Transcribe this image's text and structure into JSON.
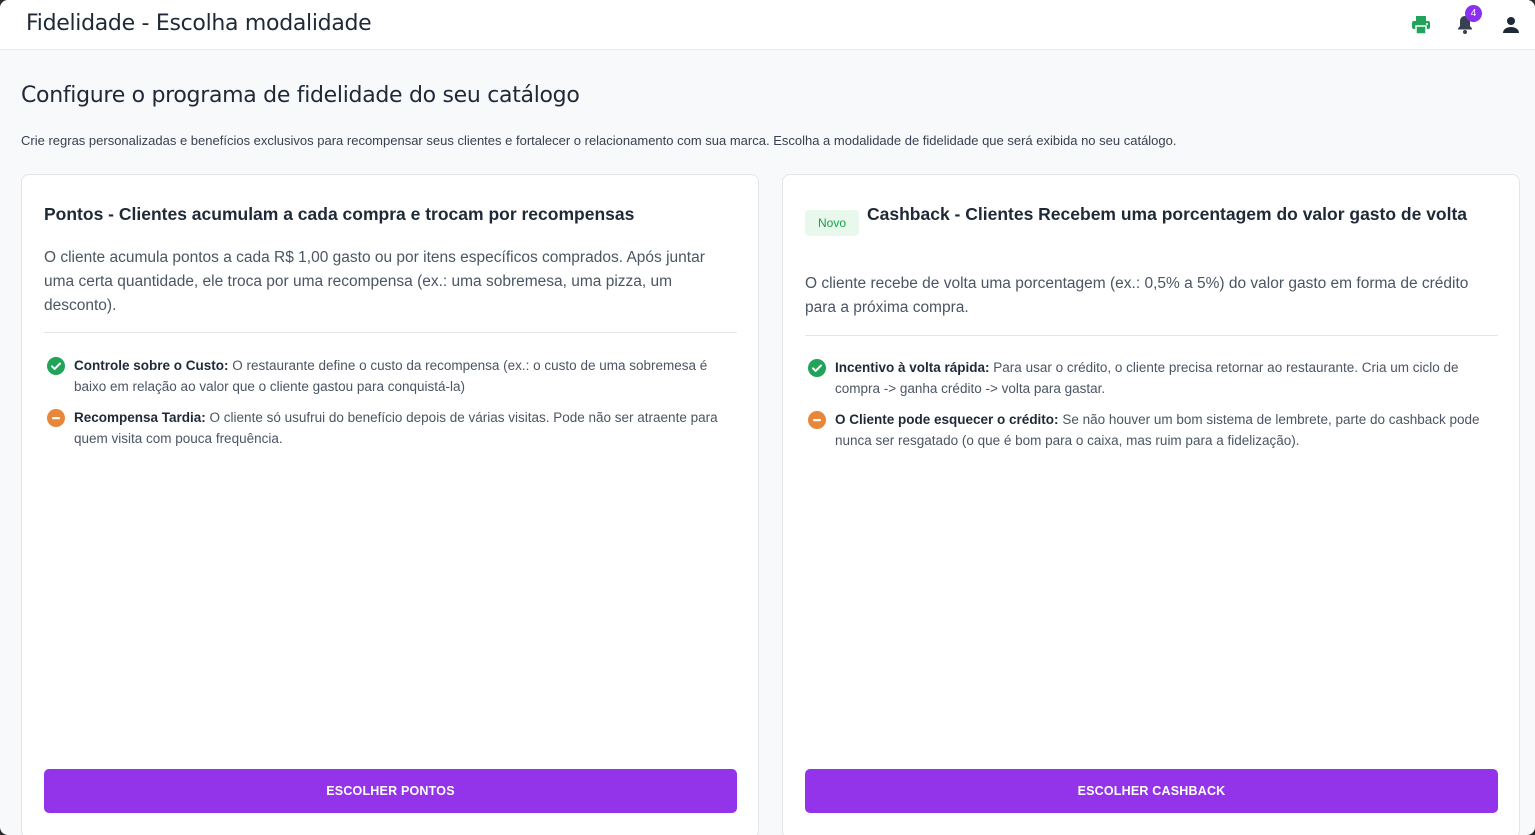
{
  "header": {
    "title": "Fidelidade - Escolha modalidade",
    "icons": [
      "printer-icon",
      "bell-icon",
      "user-icon"
    ],
    "notification_count": "4",
    "colors": {
      "printer": "#22a35a",
      "badge": "#8b2ff0"
    }
  },
  "main": {
    "heading": "Configure o programa de fidelidade do seu catálogo",
    "description": "Crie regras personalizadas e benefícios exclusivos para recompensar seus clientes e fortalecer o relacionamento com sua marca. Escolha a modalidade de fidelidade que será exibida no seu catálogo."
  },
  "cards": [
    {
      "title": "Pontos - Clientes acumulam a cada compra e trocam por recompensas",
      "description": "O cliente acumula pontos a cada R$ 1,00 gasto ou por itens específicos comprados. Após juntar uma certa quantidade, ele troca por uma recompensa (ex.: uma sobremesa, uma pizza, um desconto).",
      "points": [
        {
          "type": "pro",
          "icon": "check-circle-icon",
          "label": "Controle sobre o Custo:",
          "text": " O restaurante define o custo da recompensa (ex.: o custo de uma sobremesa é baixo em relação ao valor que o cliente gastou para conquistá-la)"
        },
        {
          "type": "con",
          "icon": "minus-circle-icon",
          "label": "Recompensa Tardia:",
          "text": " O cliente só usufrui do benefício depois de várias visitas. Pode não ser atraente para quem visita com pouca frequência."
        }
      ],
      "button": "ESCOLHER PONTOS"
    },
    {
      "badge": "Novo",
      "title": "Cashback - Clientes Recebem uma porcentagem do valor gasto de volta",
      "description": "O cliente recebe de volta uma porcentagem (ex.: 0,5% a 5%) do valor gasto em forma de crédito para a próxima compra.",
      "points": [
        {
          "type": "pro",
          "icon": "check-circle-icon",
          "label": "Incentivo à volta rápida:",
          "text": " Para usar o crédito, o cliente precisa retornar ao restaurante. Cria um ciclo de compra -> ganha crédito -> volta para gastar."
        },
        {
          "type": "con",
          "icon": "minus-circle-icon",
          "label": "O Cliente pode esquecer o crédito:",
          "text": " Se não houver um bom sistema de lembrete, parte do cashback pode nunca ser resgatado (o que é bom para o caixa, mas ruim para a fidelização)."
        }
      ],
      "button": "ESCOLHER CASHBACK"
    }
  ],
  "colors": {
    "accent": "#9333ea",
    "pro": "#22a35a",
    "con": "#e8863a",
    "novo_bg": "#e8f8ec",
    "novo_text": "#16a34a"
  }
}
